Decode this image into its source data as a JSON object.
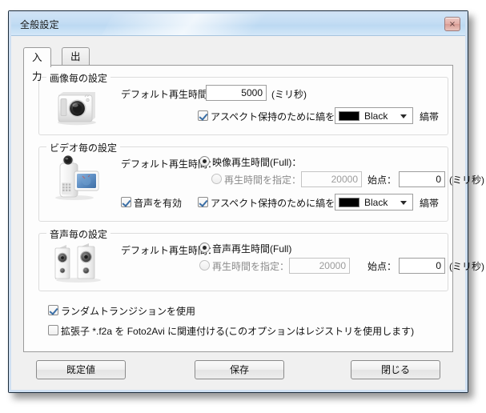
{
  "window": {
    "title": "全般設定",
    "close_label": "×"
  },
  "tabs": [
    {
      "label": "入力",
      "active": true
    },
    {
      "label": "出力",
      "active": false
    }
  ],
  "image_group": {
    "legend": "画像毎の設定",
    "icon": "camera-icon",
    "duration_label": "デフォルト再生時間",
    "duration_value": "5000",
    "unit": "(ミリ秒)",
    "aspect_checkbox_label": "アスペクト保持のために縞を付加",
    "aspect_checked": true,
    "color_value": "Black",
    "color_hex": "#000000",
    "band_label": "縞帯"
  },
  "video_group": {
    "legend": "ビデオ毎の設定",
    "icon": "camcorder-icon",
    "duration_label": "デフォルト再生時間：",
    "radio_full_label": "映像再生時間(Full)：",
    "radio_full_selected": true,
    "radio_custom_label": "再生時間を指定：",
    "radio_custom_selected": false,
    "custom_value": "20000",
    "start_label": "始点：",
    "start_value": "0",
    "unit": "(ミリ秒)",
    "audio_checkbox_label": "音声を有効",
    "audio_checked": true,
    "aspect_checkbox_label": "アスペクト保持のために縞を付加",
    "aspect_checked": true,
    "color_value": "Black",
    "color_hex": "#000000",
    "band_label": "縞帯"
  },
  "audio_group": {
    "legend": "音声毎の設定",
    "icon": "speakers-icon",
    "duration_label": "デフォルト再生時間：",
    "radio_full_label": "音声再生時間(Full)",
    "radio_full_selected": true,
    "radio_custom_label": "再生時間を指定：",
    "radio_custom_selected": false,
    "custom_value": "20000",
    "start_label": "始点：",
    "start_value": "0",
    "unit": "(ミリ秒)"
  },
  "options": {
    "random_transition_label": "ランダムトランジションを使用",
    "random_transition_checked": true,
    "associate_label": "拡張子 *.f2a を Foto2Avi に関連付ける(このオプションはレジストリを使用します)",
    "associate_checked": false
  },
  "buttons": {
    "defaults": "既定値",
    "save": "保存",
    "close": "閉じる"
  }
}
